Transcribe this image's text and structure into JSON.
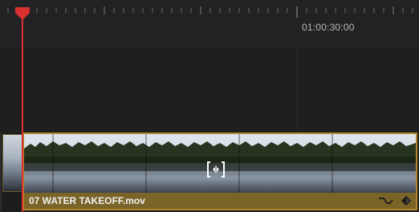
{
  "ruler": {
    "timecode": "01:00:30:00"
  },
  "clip": {
    "name": "07 WATER TAKEOFF.mov"
  },
  "icons": {
    "playhead": "playhead-icon",
    "trim": "trim-cursor-icon",
    "curve": "curve-icon",
    "keyframe": "keyframe-diamond-icon"
  },
  "colors": {
    "playhead": "#d8312f",
    "clip_border": "#b28a2e",
    "clip_footer": "#7a6428"
  }
}
